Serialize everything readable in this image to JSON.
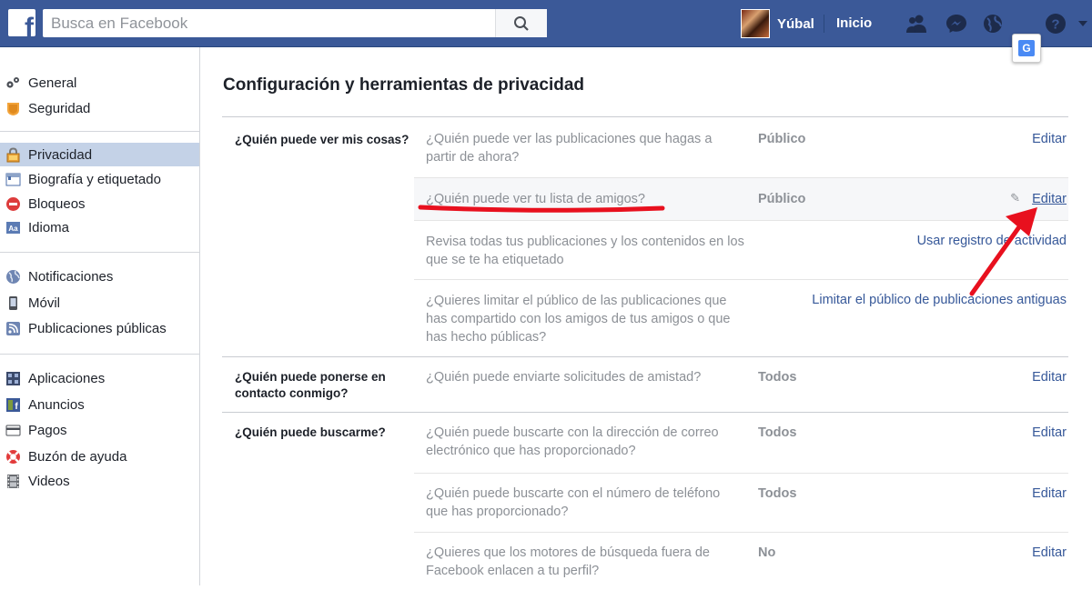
{
  "topbar": {
    "logo": "f",
    "search_placeholder": "Busca en Facebook",
    "profile_name": "Yúbal",
    "home_label": "Inicio",
    "icons": [
      "friends-icon",
      "messenger-icon",
      "globe-icon",
      "help-icon"
    ],
    "colors": {
      "brand": "#3b5998",
      "link": "#365899"
    }
  },
  "sidebar": {
    "groups": [
      [
        {
          "label": "General",
          "icon": "gears-icon"
        },
        {
          "label": "Seguridad",
          "icon": "badge-icon"
        }
      ],
      [
        {
          "label": "Privacidad",
          "icon": "lock-icon",
          "active": true
        },
        {
          "label": "Biografía y etiquetado",
          "icon": "timeline-icon"
        },
        {
          "label": "Bloqueos",
          "icon": "block-icon"
        },
        {
          "label": "Idioma",
          "icon": "language-icon"
        }
      ],
      [
        {
          "label": "Notificaciones",
          "icon": "globe-icon"
        },
        {
          "label": "Móvil",
          "icon": "mobile-icon"
        },
        {
          "label": "Publicaciones públicas",
          "icon": "rss-icon"
        }
      ],
      [
        {
          "label": "Aplicaciones",
          "icon": "apps-icon"
        },
        {
          "label": "Anuncios",
          "icon": "ads-icon"
        },
        {
          "label": "Pagos",
          "icon": "card-icon"
        },
        {
          "label": "Buzón de ayuda",
          "icon": "lifebuoy-icon"
        },
        {
          "label": "Videos",
          "icon": "film-icon"
        }
      ]
    ]
  },
  "main": {
    "title": "Configuración y herramientas de privacidad",
    "sections": [
      {
        "label": "¿Quién puede ver mis cosas?",
        "rows": [
          {
            "question": "¿Quién puede ver las publicaciones que hagas a partir de ahora?",
            "value": "Público",
            "action": "Editar"
          },
          {
            "question": "¿Quién puede ver tu lista de amigos?",
            "value": "Público",
            "action": "Editar"
          },
          {
            "question": "Revisa todas tus publicaciones y los contenidos en los que se te ha etiquetado",
            "value": "",
            "action": "Usar registro de actividad"
          },
          {
            "question": "¿Quieres limitar el público de las publicaciones que has compartido con los amigos de tus amigos o que has hecho públicas?",
            "value": "",
            "action": "Limitar el público de publicaciones antiguas"
          }
        ]
      },
      {
        "label": "¿Quién puede ponerse en contacto conmigo?",
        "rows": [
          {
            "question": "¿Quién puede enviarte solicitudes de amistad?",
            "value": "Todos",
            "action": "Editar"
          }
        ]
      },
      {
        "label": "¿Quién puede buscarme?",
        "rows": [
          {
            "question": "¿Quién puede buscarte con la dirección de correo electrónico que has proporcionado?",
            "value": "Todos",
            "action": "Editar"
          },
          {
            "question": "¿Quién puede buscarte con el número de teléfono que has proporcionado?",
            "value": "Todos",
            "action": "Editar"
          },
          {
            "question": "¿Quieres que los motores de búsqueda fuera de Facebook enlacen a tu perfil?",
            "value": "No",
            "action": "Editar"
          }
        ]
      }
    ]
  },
  "annotation": {
    "underline_color": "#e8101e",
    "arrow_color": "#e8101e"
  }
}
